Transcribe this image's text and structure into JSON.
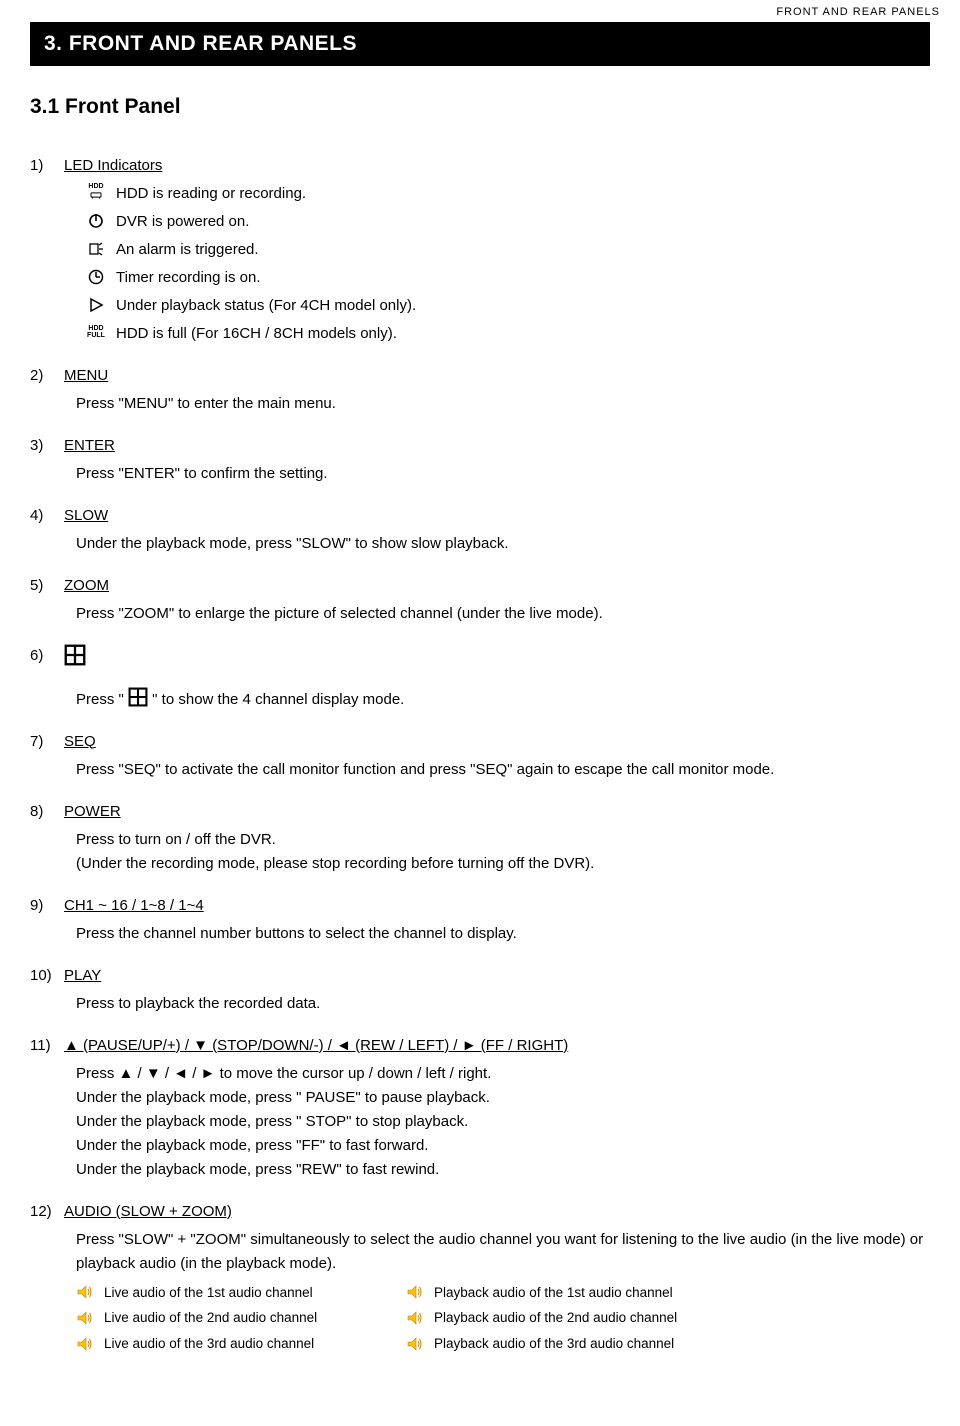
{
  "header": {
    "running": "FRONT AND REAR PANELS"
  },
  "title": "3. FRONT AND REAR PANELS",
  "subsection": "3.1 Front Panel",
  "items": {
    "1": {
      "num": "1)",
      "label": "LED Indicators",
      "leds": {
        "hdd": {
          "tag": "HDD",
          "desc": "HDD is reading or recording."
        },
        "power": {
          "desc": "DVR is powered on."
        },
        "alarm": {
          "desc": "An alarm is triggered."
        },
        "timer": {
          "desc": "Timer recording is on."
        },
        "play": {
          "desc": "Under playback status (For 4CH model only)."
        },
        "hddfull": {
          "tag1": "HDD",
          "tag2": "FULL",
          "desc": "HDD is full (For 16CH / 8CH models only)."
        }
      }
    },
    "2": {
      "num": "2)",
      "label": "MENU",
      "body": "Press \"MENU\" to enter the main menu."
    },
    "3": {
      "num": "3)",
      "label": "ENTER",
      "body": "Press \"ENTER\" to confirm the setting."
    },
    "4": {
      "num": "4)",
      "label": "SLOW",
      "body": "Under the playback mode, press \"SLOW\" to show slow playback."
    },
    "5": {
      "num": "5)",
      "label": "ZOOM",
      "body": "Press \"ZOOM\" to enlarge the picture of selected channel (under the live mode)."
    },
    "6": {
      "num": "6)",
      "body_prefix": "Press \" ",
      "body_suffix": " \" to show the 4 channel display mode."
    },
    "7": {
      "num": "7)",
      "label": "SEQ",
      "body": "Press \"SEQ\" to activate the call monitor function and press \"SEQ\" again to escape the call monitor mode."
    },
    "8": {
      "num": "8)",
      "label": "POWER",
      "body1": "Press to turn on / off the DVR.",
      "body2": "(Under the recording mode, please stop recording before turning off the DVR)."
    },
    "9": {
      "num": "9)",
      "label": "CH1 ~ 16 / 1~8 / 1~4",
      "body": "Press the channel number buttons to select the channel to display."
    },
    "10": {
      "num": "10)",
      "label": "PLAY",
      "body": "Press to playback the recorded data."
    },
    "11": {
      "num": "11)",
      "label": "▲ (PAUSE/UP/+) / ▼ (STOP/DOWN/-) / ◄ (REW / LEFT) / ► (FF / RIGHT)",
      "line1": "Press ▲ / ▼ / ◄ / ► to move the cursor up / down / left / right.",
      "line2": "Under the playback mode, press \" PAUSE\" to pause playback.",
      "line3": "Under the playback mode, press \" STOP\" to stop playback.",
      "line4": "Under the playback mode, press \"FF\" to fast forward.",
      "line5": "Under the playback mode, press \"REW\" to fast rewind."
    },
    "12": {
      "num": "12)",
      "label": "AUDIO (SLOW + ZOOM)",
      "body": "Press \"SLOW\" + \"ZOOM\" simultaneously to select the audio channel you want for listening to the live audio (in the live mode) or playback audio (in the playback mode).",
      "live1": "Live audio of the 1st audio channel",
      "live2": "Live audio of the 2nd audio channel",
      "live3": "Live audio of the 3rd audio channel",
      "pb1": "Playback audio of the 1st audio channel",
      "pb2": "Playback audio of the 2nd audio channel",
      "pb3": "Playback audio of the 3rd audio channel"
    }
  }
}
